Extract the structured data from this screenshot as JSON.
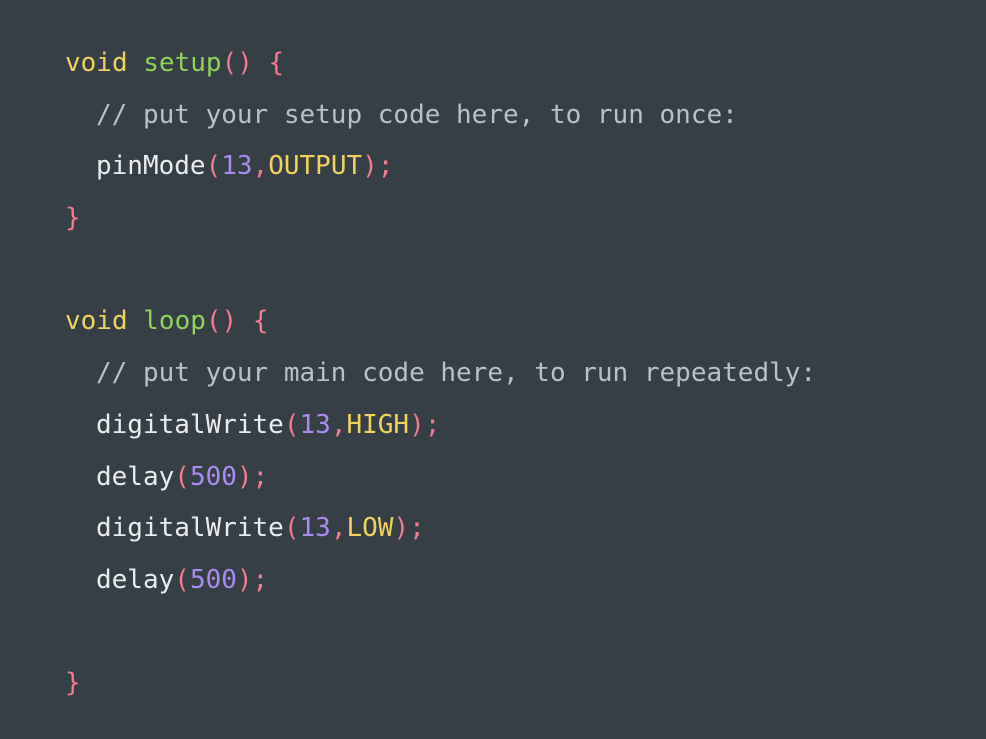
{
  "colors": {
    "background": "#353f45",
    "keyword": "#f0d25c",
    "function": "#8fd35a",
    "punct": "#f47b8f",
    "comment": "#b9c0c6",
    "number": "#a98bf0",
    "constant": "#f0d25c",
    "plain": "#e8ecef"
  },
  "lines": [
    {
      "indent": false,
      "tokens": [
        {
          "t": "void",
          "k": "keyword"
        },
        {
          "t": " ",
          "k": "plain"
        },
        {
          "t": "setup",
          "k": "function"
        },
        {
          "t": "()",
          "k": "punct"
        },
        {
          "t": " ",
          "k": "plain"
        },
        {
          "t": "{",
          "k": "punct"
        }
      ]
    },
    {
      "indent": true,
      "tokens": [
        {
          "t": "// put your setup code here, to run once:",
          "k": "comment"
        }
      ]
    },
    {
      "indent": true,
      "tokens": [
        {
          "t": "pinMode",
          "k": "plain"
        },
        {
          "t": "(",
          "k": "punct"
        },
        {
          "t": "13",
          "k": "number"
        },
        {
          "t": ",",
          "k": "punct"
        },
        {
          "t": "OUTPUT",
          "k": "constant"
        },
        {
          "t": ");",
          "k": "punct"
        }
      ]
    },
    {
      "indent": false,
      "tokens": [
        {
          "t": "}",
          "k": "punct"
        }
      ]
    },
    {
      "indent": false,
      "tokens": []
    },
    {
      "indent": false,
      "tokens": [
        {
          "t": "void",
          "k": "keyword"
        },
        {
          "t": " ",
          "k": "plain"
        },
        {
          "t": "loop",
          "k": "function"
        },
        {
          "t": "()",
          "k": "punct"
        },
        {
          "t": " ",
          "k": "plain"
        },
        {
          "t": "{",
          "k": "punct"
        }
      ]
    },
    {
      "indent": true,
      "tokens": [
        {
          "t": "// put your main code here, to run repeatedly:",
          "k": "comment"
        }
      ]
    },
    {
      "indent": true,
      "tokens": [
        {
          "t": "digitalWrite",
          "k": "plain"
        },
        {
          "t": "(",
          "k": "punct"
        },
        {
          "t": "13",
          "k": "number"
        },
        {
          "t": ",",
          "k": "punct"
        },
        {
          "t": "HIGH",
          "k": "constant"
        },
        {
          "t": ");",
          "k": "punct"
        }
      ]
    },
    {
      "indent": true,
      "tokens": [
        {
          "t": "delay",
          "k": "plain"
        },
        {
          "t": "(",
          "k": "punct"
        },
        {
          "t": "500",
          "k": "number"
        },
        {
          "t": ");",
          "k": "punct"
        }
      ]
    },
    {
      "indent": true,
      "tokens": [
        {
          "t": "digitalWrite",
          "k": "plain"
        },
        {
          "t": "(",
          "k": "punct"
        },
        {
          "t": "13",
          "k": "number"
        },
        {
          "t": ",",
          "k": "punct"
        },
        {
          "t": "LOW",
          "k": "constant"
        },
        {
          "t": ");",
          "k": "punct"
        }
      ]
    },
    {
      "indent": true,
      "tokens": [
        {
          "t": "delay",
          "k": "plain"
        },
        {
          "t": "(",
          "k": "punct"
        },
        {
          "t": "500",
          "k": "number"
        },
        {
          "t": ");",
          "k": "punct"
        }
      ]
    },
    {
      "indent": false,
      "tokens": []
    },
    {
      "indent": false,
      "tokens": [
        {
          "t": "}",
          "k": "punct"
        }
      ]
    }
  ]
}
